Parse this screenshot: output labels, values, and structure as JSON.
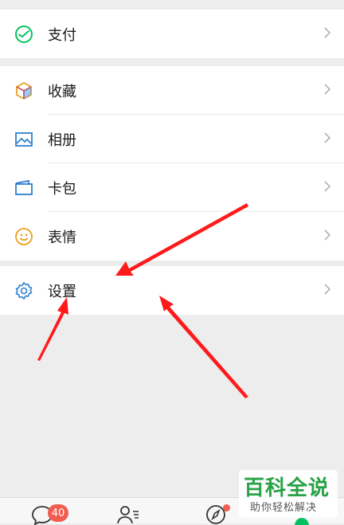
{
  "menu": {
    "pay": {
      "label": "支付",
      "icon": "wallet-check-icon"
    },
    "favorites": {
      "label": "收藏",
      "icon": "cube-icon"
    },
    "album": {
      "label": "相册",
      "icon": "image-icon"
    },
    "cards": {
      "label": "卡包",
      "icon": "card-icon"
    },
    "stickers": {
      "label": "表情",
      "icon": "smile-icon"
    },
    "settings": {
      "label": "设置",
      "icon": "gear-icon"
    }
  },
  "tabbar": {
    "chats_badge": "40",
    "discover_has_dot": true
  },
  "watermark": {
    "title": "百科全说",
    "subtitle": "助你轻松解决"
  },
  "colors": {
    "accent_green": "#07c160",
    "badge_red": "#f25b4f",
    "arrow_red": "#ff1a1a",
    "icon_blue": "#2f7fd0"
  }
}
